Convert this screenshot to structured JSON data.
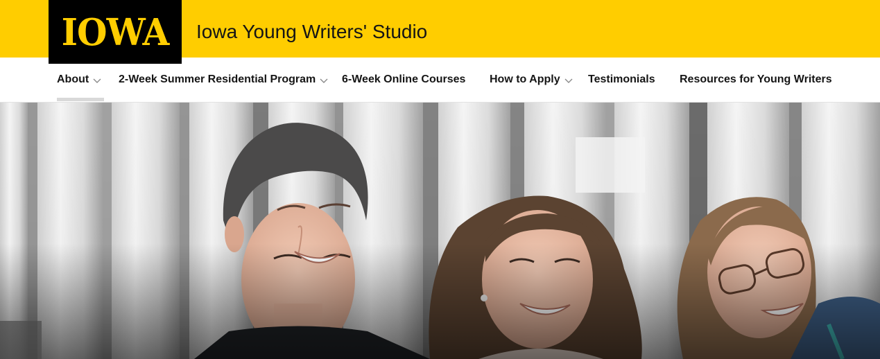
{
  "brand": {
    "logo_text": "IOWA",
    "site_title": "Iowa Young Writers' Studio",
    "colors": {
      "gold": "#FFCD00",
      "black": "#000000"
    }
  },
  "nav": {
    "items": [
      {
        "label": "About",
        "has_dropdown": true,
        "active": true
      },
      {
        "label": "2-Week Summer Residential Program",
        "has_dropdown": true,
        "active": false
      },
      {
        "label": "6-Week Online Courses",
        "has_dropdown": false,
        "active": false
      },
      {
        "label": "How to Apply",
        "has_dropdown": true,
        "active": false
      },
      {
        "label": "Testimonials",
        "has_dropdown": false,
        "active": false
      },
      {
        "label": "Resources for Young Writers",
        "has_dropdown": false,
        "active": false
      }
    ],
    "dropdown_icon": "chevron-down-icon"
  },
  "hero": {
    "image_subject": "three smiling students in front of a metal-slatted wall"
  }
}
